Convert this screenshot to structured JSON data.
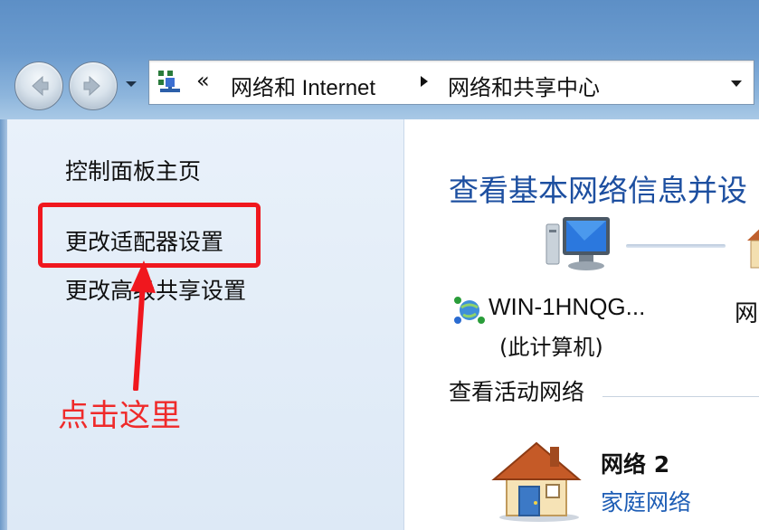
{
  "address_bar": {
    "overflow_glyph": "«",
    "crumbs": [
      "网络和 Internet",
      "网络和共享中心"
    ]
  },
  "left_pane": {
    "links": [
      "控制面板主页",
      "更改适配器设置",
      "更改高级共享设置"
    ],
    "annotation": "点击这里"
  },
  "main": {
    "heading": "查看基本网络信息并设",
    "computer_name": "WIN-1HNQG...",
    "computer_sub": "(此计算机)",
    "network_partial": "网",
    "active_networks_title": "查看活动网络",
    "network_name": "网络  2",
    "network_type": "家庭网络"
  },
  "colors": {
    "highlight": "#f0171e",
    "annotation": "#ef2a2a",
    "heading": "#1d4fa0",
    "link": "#1d5db5"
  },
  "icons": {
    "back": "back-arrow-icon",
    "forward": "forward-arrow-icon",
    "network_control_panel": "network-center-icon",
    "computer": "monitor-icon",
    "globe": "network-globe-icon",
    "home_network": "house-icon"
  }
}
